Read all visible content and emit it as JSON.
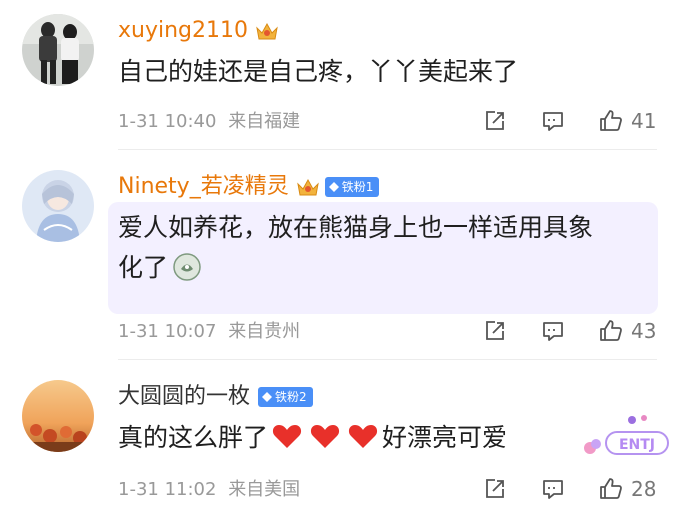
{
  "colors": {
    "username_orange": "#e8780a",
    "username_dark": "#333333",
    "fan_badge_blue": "#4a8ff7",
    "fan_badge_orange": "#f5a623",
    "bubble_lavender": "#f3f0ff",
    "heart_red": "#e8302a",
    "meta_gray": "#999999"
  },
  "comments": [
    {
      "username": "xuying2110",
      "text": "自己的娃还是自己疼，丫丫美起来了",
      "time": "1-31 10:40",
      "location": "来自福建",
      "likes": "41",
      "badge_icon": "crown-icon"
    },
    {
      "username": "Ninety_若凌精灵",
      "fan_badge": "铁粉1",
      "text_line1": "爱人如养花，放在熊猫身上也一样适用具象",
      "text_line2": "化了",
      "time": "1-31 10:07",
      "location": "来自贵州",
      "likes": "43",
      "badge_icon": "crown-icon",
      "sticker_text": "ENTJ"
    },
    {
      "username": "大圆圆的一枚",
      "fan_badge": "铁粉2",
      "text_before": "真的这么胖了",
      "text_after": "好漂亮可爱",
      "time": "1-31 11:02",
      "location": "来自美国",
      "likes": "28"
    }
  ]
}
